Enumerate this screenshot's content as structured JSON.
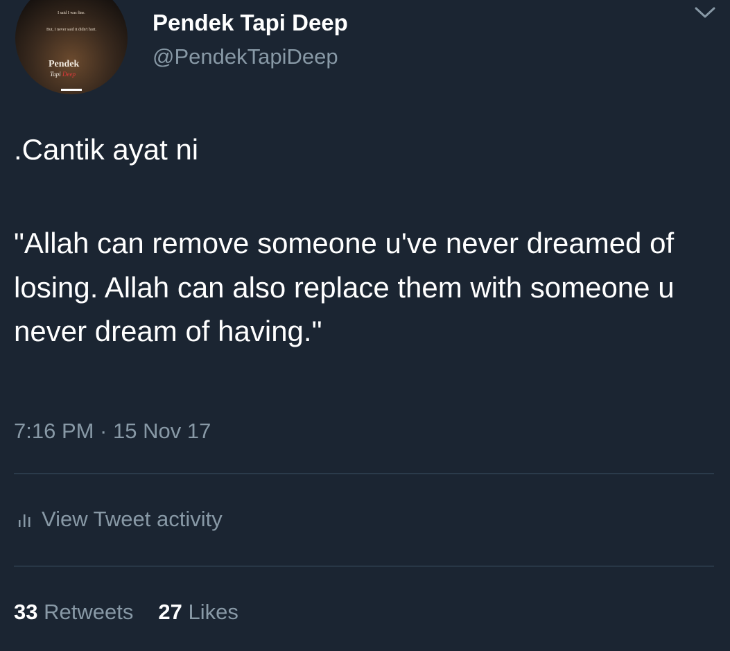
{
  "author": {
    "display_name": "Pendek Tapi Deep",
    "handle": "@PendekTapiDeep",
    "avatar": {
      "line1": "I said I was fine.",
      "line2": "But, I never said it didn't hurt.",
      "brand": "Pendek",
      "brand_sub_a": "Tapi",
      "brand_sub_b": "Deep"
    }
  },
  "menu_icon": "chevron-down-icon",
  "tweet": {
    "line1": ".Cantik ayat ni",
    "quote": "\"Allah can remove someone u've never dreamed of losing. Allah can also replace them with someone u never dream of having.\"",
    "timestamp": "7:16 PM · 15 Nov 17"
  },
  "activity": {
    "icon": "bar-chart-icon",
    "label": "View Tweet activity"
  },
  "stats": {
    "retweets_count": "33",
    "retweets_label": "Retweets",
    "likes_count": "27",
    "likes_label": "Likes"
  },
  "colors": {
    "background": "#1b2532",
    "text": "#ffffff",
    "secondary": "#8899a6",
    "divider": "#3d5466"
  }
}
